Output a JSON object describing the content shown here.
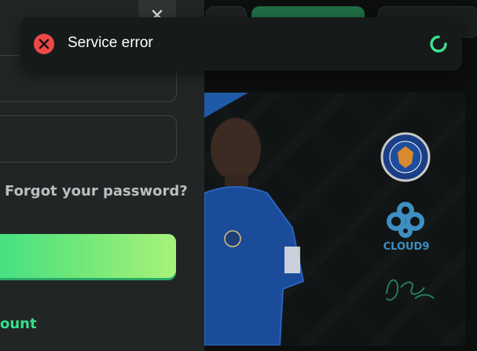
{
  "login": {
    "forgot_password": "Forgot your password?",
    "create_account_partial": "ount"
  },
  "toast": {
    "message": "Service error",
    "status_color": "#f04848",
    "spinner_color": "#3ee08f"
  },
  "icons": {
    "close": "close-icon",
    "error": "error-x-icon",
    "spinner": "loading-spinner-icon"
  },
  "colors": {
    "accent": "#36e08a",
    "panel": "#222526",
    "background": "#0d0f0f"
  }
}
